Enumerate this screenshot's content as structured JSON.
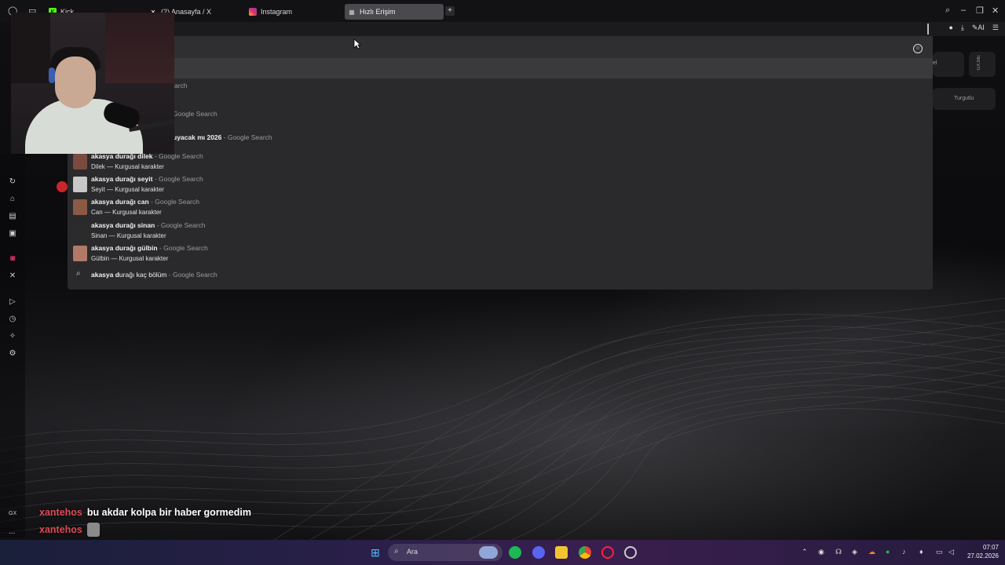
{
  "tabs": [
    {
      "label": "Kick",
      "favicon": "kick-icon",
      "active": false
    },
    {
      "label": "(2) Anasayfa / X",
      "favicon": "x-icon",
      "active": false
    },
    {
      "label": "Instagram",
      "favicon": "instagram-icon",
      "active": false
    },
    {
      "label": "Hızlı Erişim",
      "favicon": "speed-dial-icon",
      "active": true
    }
  ],
  "toolbar": {
    "ai_label": "AI"
  },
  "dropdown": {
    "partial_top": "arch",
    "partial_google": "Google Search",
    "partial_query_rest": "uyacak mı 2026",
    "partial_query_suffix": "- Google Search",
    "suggestions": [
      {
        "query": "akasya durağı dilek",
        "suffix": "- Google Search",
        "subtitle": "Dilek — Kurgusal karakter",
        "thumb_color": "#7a4a3e"
      },
      {
        "query": "akasya durağı seyit",
        "suffix": "- Google Search",
        "subtitle": "Seyit — Kurgusal karakter",
        "thumb_color": "#c8c8c8"
      },
      {
        "query": "akasya durağı can",
        "suffix": "- Google Search",
        "subtitle": "Can — Kurgusal karakter",
        "thumb_color": "#8b5a44"
      },
      {
        "query": "akasya durağı sinan",
        "suffix": "- Google Search",
        "subtitle": "Sinan — Kurgusal karakter",
        "thumb_color": "#2b2b2b"
      },
      {
        "query": "akasya durağı gülbin",
        "suffix": "- Google Search",
        "subtitle": "Gülbin — Kurgusal karakter",
        "thumb_color": "#b07a66"
      }
    ],
    "last": {
      "query_bold": "akasya d",
      "query_rest": "urağı kaç bölüm",
      "suffix": "- Google Search"
    }
  },
  "speed_dial": {
    "tile1_label": "el",
    "tile2_label": "GX.ME",
    "tile3_label": "Turgutlu"
  },
  "chat": [
    {
      "user": "xantehos",
      "message": "bu akdar kolpa bir haber gormedim"
    },
    {
      "user": "xantehos",
      "message": ""
    }
  ],
  "sidebar": {
    "gx_label": "GX",
    "more": "..."
  },
  "taskbar": {
    "search_placeholder": "Ara",
    "time": "07:07",
    "date": "27.02.2026"
  }
}
